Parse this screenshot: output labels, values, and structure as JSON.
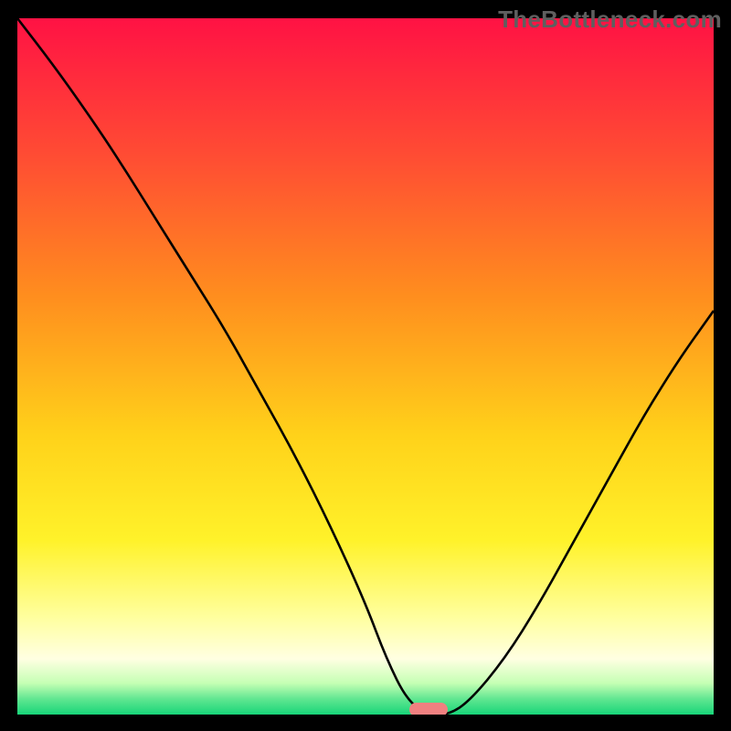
{
  "watermark": "TheBottleneck.com",
  "colors": {
    "frame": "#000000",
    "gradient_stops": [
      {
        "offset": 0.0,
        "color": "#ff1244"
      },
      {
        "offset": 0.2,
        "color": "#ff4d33"
      },
      {
        "offset": 0.4,
        "color": "#ff8e1e"
      },
      {
        "offset": 0.6,
        "color": "#ffd21a"
      },
      {
        "offset": 0.75,
        "color": "#fff22a"
      },
      {
        "offset": 0.86,
        "color": "#ffff9e"
      },
      {
        "offset": 0.92,
        "color": "#ffffe2"
      },
      {
        "offset": 0.955,
        "color": "#c5ffb4"
      },
      {
        "offset": 0.978,
        "color": "#5fe690"
      },
      {
        "offset": 1.0,
        "color": "#18d579"
      }
    ],
    "curve": "#000000",
    "marker": "#f08080"
  },
  "chart_data": {
    "type": "line",
    "title": "",
    "xlabel": "",
    "ylabel": "",
    "xlim": [
      0,
      100
    ],
    "ylim": [
      0,
      100
    ],
    "series": [
      {
        "name": "bottleneck-curve",
        "x": [
          0,
          5,
          10,
          15,
          20,
          25,
          30,
          35,
          40,
          45,
          50,
          53,
          56,
          59,
          62,
          65,
          70,
          75,
          80,
          85,
          90,
          95,
          100
        ],
        "y": [
          100,
          93.5,
          86.5,
          79,
          71,
          63,
          55,
          46,
          37,
          27,
          16,
          8,
          2,
          0,
          0,
          2,
          8,
          16,
          25,
          34,
          43,
          51,
          58
        ]
      }
    ],
    "flat_segment": {
      "x_start": 56,
      "x_end": 62,
      "y": 0
    },
    "marker": {
      "x_center": 59,
      "y": 0,
      "width_pct": 5.5
    }
  }
}
